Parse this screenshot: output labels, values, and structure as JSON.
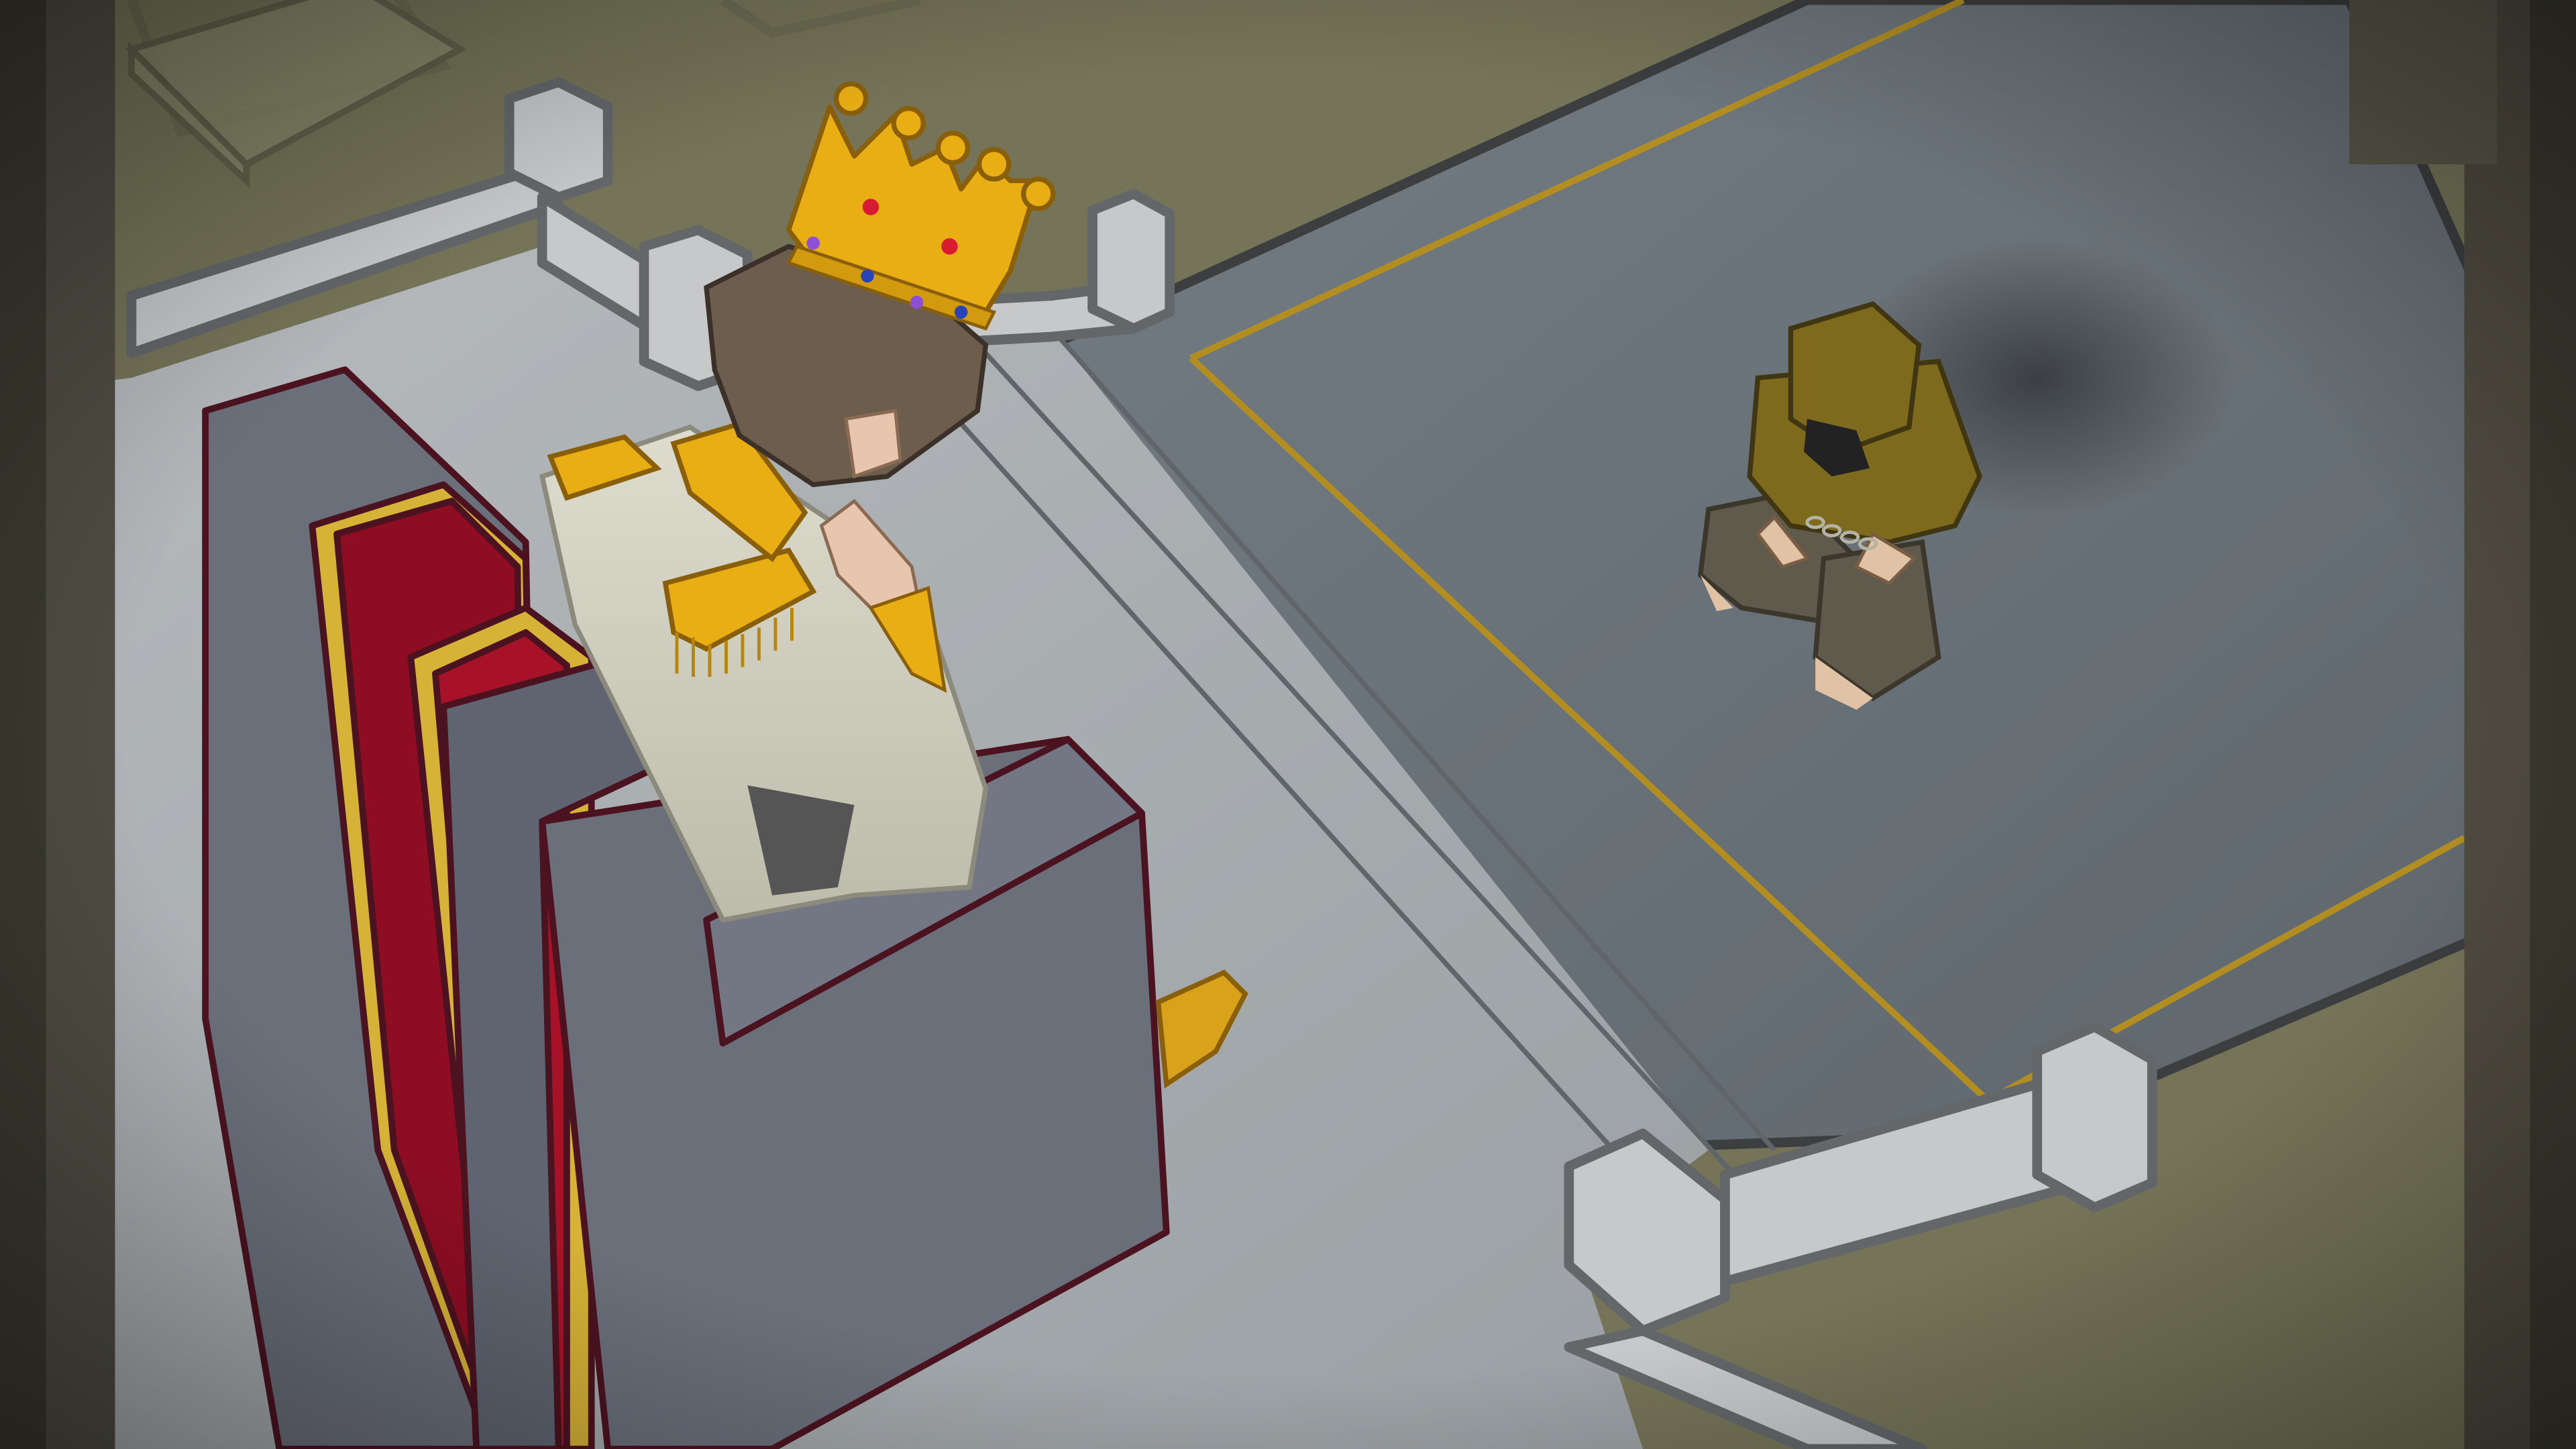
{
  "scene": {
    "kind": "isometric illustration",
    "palette": {
      "floor_olive": "#757458",
      "dais_stone": "#a7acaf",
      "carpet_slate": "#6c757c",
      "gold_trim": "#b28e22",
      "throne_gray": "#6a6f7a",
      "throne_red": "#8e0d22",
      "gold": "#e8ae14",
      "coat_cream": "#cfcdbd",
      "hair_brown": "#6c5d4d",
      "skin": "#e7c6ad",
      "hood_olive": "#7d6a1d",
      "shadow_dark": "#3b3d3b"
    }
  },
  "elements": [
    {
      "name": "throne-room-floor"
    },
    {
      "name": "raised-dais"
    },
    {
      "name": "slate-carpet-with-gold-border"
    },
    {
      "name": "stone-balustrade-back"
    },
    {
      "name": "stone-balustrade-front"
    },
    {
      "name": "stone-pillar-left"
    },
    {
      "name": "stone-pillar-right"
    },
    {
      "name": "king-on-throne"
    },
    {
      "name": "throne"
    },
    {
      "name": "crown-icon"
    },
    {
      "name": "hooded-prisoner-kneeling"
    },
    {
      "name": "wrist-chains-icon"
    },
    {
      "name": "vignette"
    }
  ]
}
